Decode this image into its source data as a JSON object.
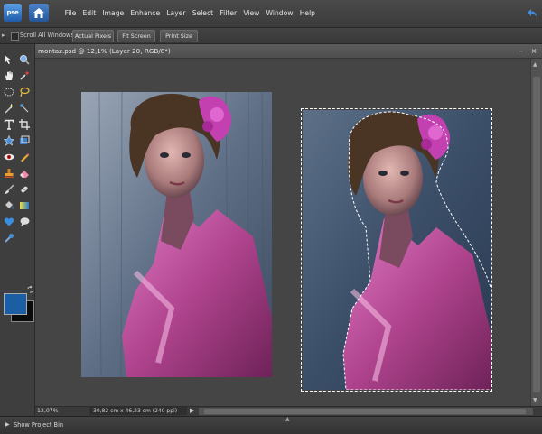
{
  "app": {
    "logo_text": "pse"
  },
  "menu": {
    "items": [
      "File",
      "Edit",
      "Image",
      "Enhance",
      "Layer",
      "Select",
      "Filter",
      "View",
      "Window",
      "Help"
    ]
  },
  "options": {
    "scroll_all_label": "Scroll All Windows",
    "actual_pixels_label": "Actual Pixels",
    "fit_screen_label": "Fit Screen",
    "print_size_label": "Print Size"
  },
  "document": {
    "title": "montaz.psd @ 12,1% (Layer 20, RGB/8*)",
    "minimize": "–",
    "close": "×"
  },
  "status": {
    "zoom": "12,07%",
    "dimensions": "30,82 cm x 46,23 cm (240 ppi)"
  },
  "bin": {
    "label": "Show Project Bin"
  },
  "colors": {
    "foreground": "#1b5ea3",
    "background": "#0b0b0b",
    "accent": "#2f6cb5"
  }
}
